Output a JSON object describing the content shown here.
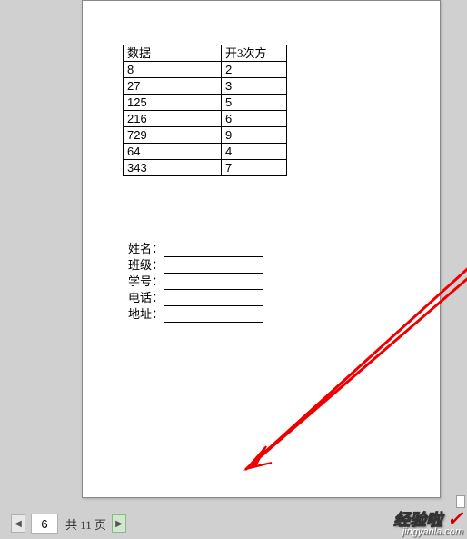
{
  "chart_data": {
    "type": "table",
    "headers": [
      "数据",
      "开3次方"
    ],
    "rows": [
      [
        "8",
        "2"
      ],
      [
        "27",
        "3"
      ],
      [
        "125",
        "5"
      ],
      [
        "216",
        "6"
      ],
      [
        "729",
        "9"
      ],
      [
        "64",
        "4"
      ],
      [
        "343",
        "7"
      ]
    ]
  },
  "form": {
    "fields": [
      {
        "label": "姓名："
      },
      {
        "label": "班级："
      },
      {
        "label": "学号："
      },
      {
        "label": "电话："
      },
      {
        "label": "地址："
      }
    ]
  },
  "nav": {
    "prev": "◀",
    "next": "▶",
    "current": "6",
    "total_label": "共 11 页"
  },
  "watermark": {
    "line1": "经验啦",
    "check": "✓",
    "line2": "jingyanla.com"
  }
}
